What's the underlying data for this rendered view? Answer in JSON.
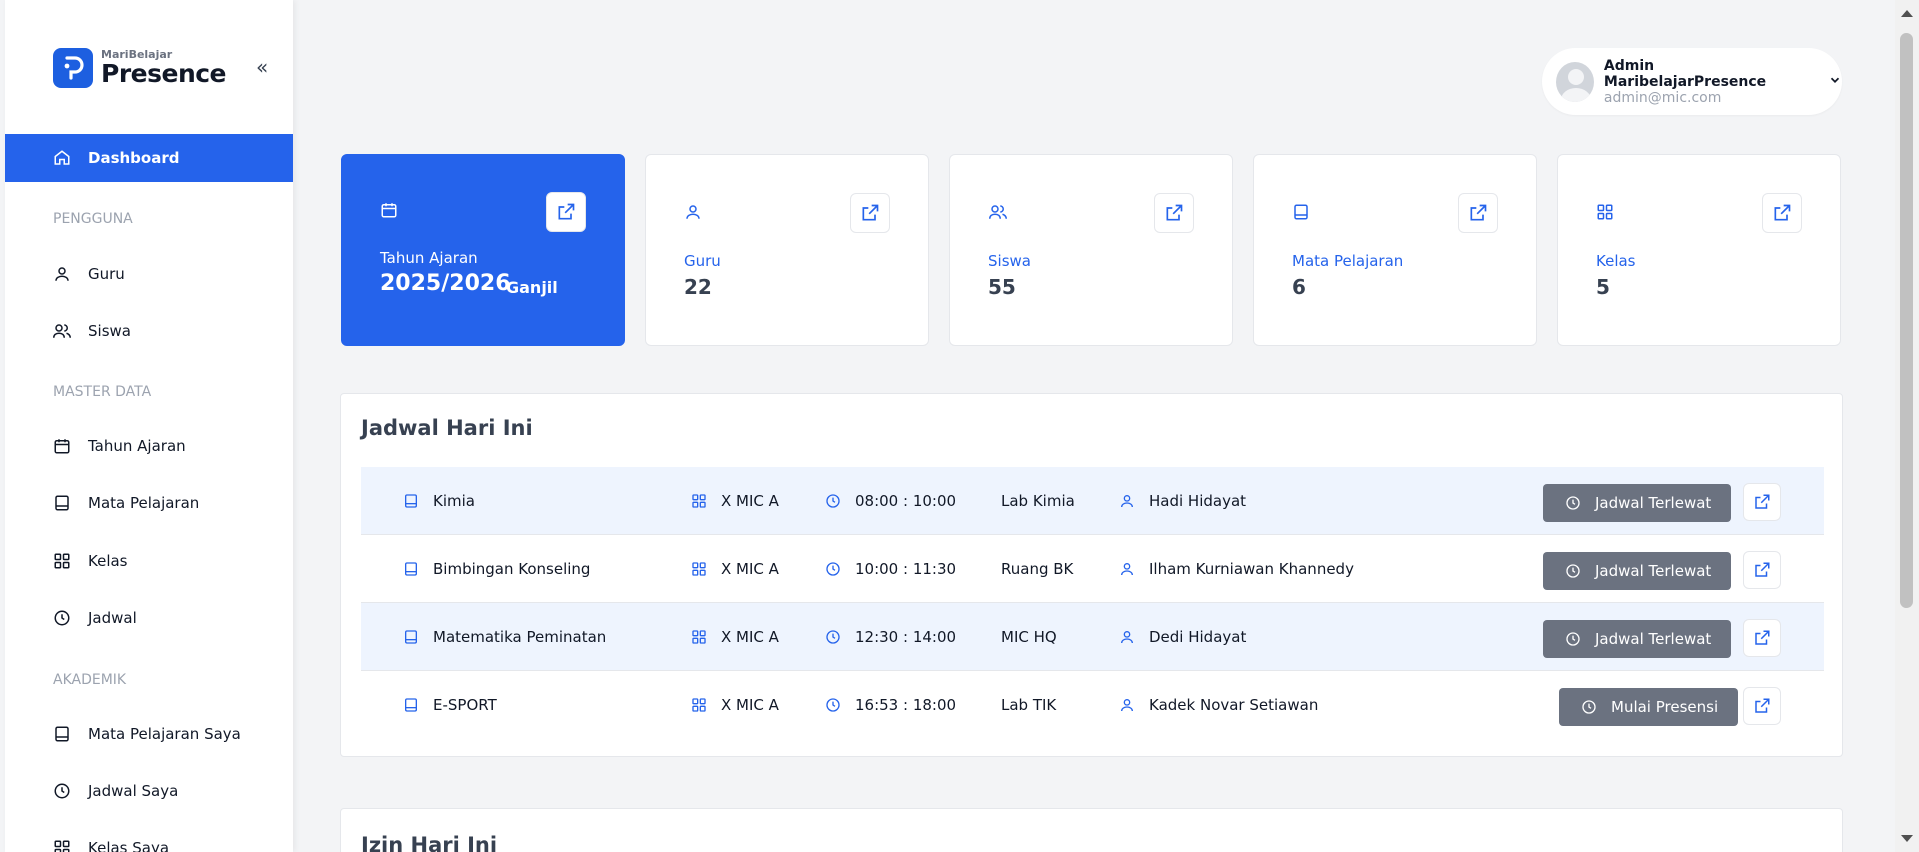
{
  "brand": {
    "small": "MariBelajar",
    "big": "Presence"
  },
  "nav": {
    "active": "Dashboard",
    "sections": [
      {
        "title": "PENGGUNA",
        "items": [
          "Guru",
          "Siswa"
        ]
      },
      {
        "title": "MASTER DATA",
        "items": [
          "Tahun Ajaran",
          "Mata Pelajaran",
          "Kelas",
          "Jadwal"
        ]
      },
      {
        "title": "AKADEMIK",
        "items": [
          "Mata Pelajaran Saya",
          "Jadwal Saya",
          "Kelas Saya"
        ]
      }
    ]
  },
  "user": {
    "name": "Admin MaribelajarPresence",
    "email": "admin@mic.com"
  },
  "cards": [
    {
      "label": "Tahun Ajaran",
      "value": "2025/2026",
      "sub": "Ganjil"
    },
    {
      "label": "Guru",
      "value": "22"
    },
    {
      "label": "Siswa",
      "value": "55"
    },
    {
      "label": "Mata Pelajaran",
      "value": "6"
    },
    {
      "label": "Kelas",
      "value": "5"
    }
  ],
  "schedule": {
    "title": "Jadwal Hari Ini",
    "rows": [
      {
        "subject": "Kimia",
        "class": "X MIC A",
        "time": "08:00 : 10:00",
        "room": "Lab Kimia",
        "teacher": "Hadi Hidayat",
        "status": "Jadwal Terlewat"
      },
      {
        "subject": "Bimbingan Konseling",
        "class": "X MIC A",
        "time": "10:00 : 11:30",
        "room": "Ruang BK",
        "teacher": "Ilham Kurniawan Khannedy",
        "status": "Jadwal Terlewat"
      },
      {
        "subject": "Matematika Peminatan",
        "class": "X MIC A",
        "time": "12:30 : 14:00",
        "room": "MIC HQ",
        "teacher": "Dedi Hidayat",
        "status": "Jadwal Terlewat"
      },
      {
        "subject": "E-SPORT",
        "class": "X MIC A",
        "time": "16:53 : 18:00",
        "room": "Lab TIK",
        "teacher": "Kadek Novar Setiawan",
        "status": "Mulai Presensi"
      }
    ]
  },
  "izin": {
    "title": "Izin Hari Ini"
  },
  "colors": {
    "primary": "#2563eb",
    "status_gray": "#6b7280",
    "row_highlight": "#eef4fe"
  },
  "icons": {
    "nav": [
      "home-icon",
      "user-icon",
      "users-icon",
      "calendar-icon",
      "book-icon",
      "grid-icon",
      "clock-icon"
    ],
    "actions": [
      "external-link-icon",
      "chevron-down-icon",
      "collapse-icon"
    ]
  }
}
